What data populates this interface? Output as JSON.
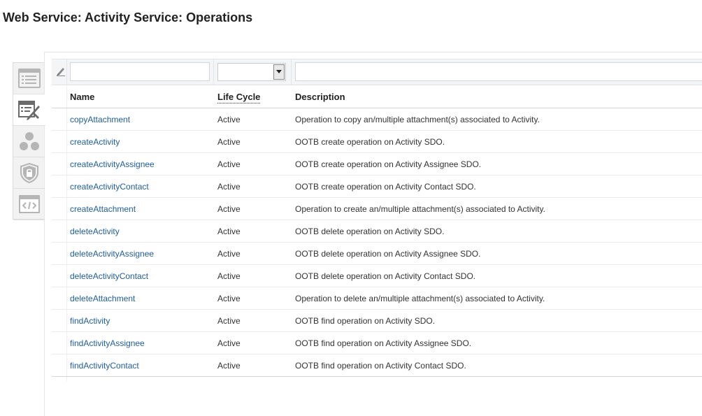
{
  "page": {
    "title": "Web Service: Activity Service: Operations"
  },
  "tabs": [
    {
      "icon": "details-list-icon",
      "active": false
    },
    {
      "icon": "operations-edit-icon",
      "active": true
    },
    {
      "icon": "objects-circles-icon",
      "active": false
    },
    {
      "icon": "security-shield-icon",
      "active": false
    },
    {
      "icon": "code-icon",
      "active": false
    }
  ],
  "filters": {
    "name_value": "",
    "lifecycle_value": "",
    "description_value": ""
  },
  "table": {
    "columns": {
      "name": "Name",
      "lifecycle": "Life Cycle",
      "description": "Description"
    },
    "rows": [
      {
        "name": "copyAttachment",
        "lifecycle": "Active",
        "description": "Operation to copy an/multiple attachment(s) associated to Activity."
      },
      {
        "name": "createActivity",
        "lifecycle": "Active",
        "description": "OOTB create operation on Activity SDO."
      },
      {
        "name": "createActivityAssignee",
        "lifecycle": "Active",
        "description": "OOTB create operation on Activity Assignee SDO."
      },
      {
        "name": "createActivityContact",
        "lifecycle": "Active",
        "description": "OOTB create operation on Activity Contact SDO."
      },
      {
        "name": "createAttachment",
        "lifecycle": "Active",
        "description": "Operation to create an/multiple attachment(s) associated to Activity."
      },
      {
        "name": "deleteActivity",
        "lifecycle": "Active",
        "description": "OOTB delete operation on Activity SDO."
      },
      {
        "name": "deleteActivityAssignee",
        "lifecycle": "Active",
        "description": "OOTB delete operation on Activity Assignee SDO."
      },
      {
        "name": "deleteActivityContact",
        "lifecycle": "Active",
        "description": "OOTB delete operation on Activity Contact SDO."
      },
      {
        "name": "deleteAttachment",
        "lifecycle": "Active",
        "description": "Operation to delete an/multiple attachment(s) associated to Activity."
      },
      {
        "name": "findActivity",
        "lifecycle": "Active",
        "description": "OOTB find operation on Activity SDO."
      },
      {
        "name": "findActivityAssignee",
        "lifecycle": "Active",
        "description": "OOTB find operation on Activity Assignee SDO."
      },
      {
        "name": "findActivityContact",
        "lifecycle": "Active",
        "description": "OOTB find operation on Activity Contact SDO."
      }
    ]
  },
  "colors": {
    "link": "#1f5d9c",
    "tab_icon": "#b5b5b5",
    "tab_icon_active": "#6a6a6a"
  }
}
